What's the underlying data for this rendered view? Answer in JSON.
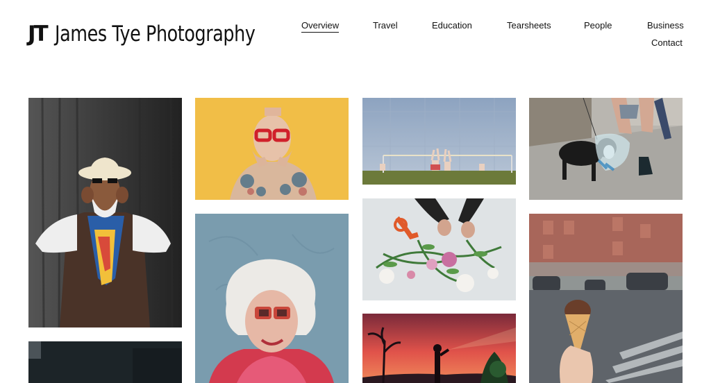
{
  "site": {
    "logo_mark": "JT",
    "title": "James Tye Photography"
  },
  "nav": {
    "items": [
      {
        "label": "Overview",
        "active": true
      },
      {
        "label": "Travel"
      },
      {
        "label": "Education"
      },
      {
        "label": "Tearsheets"
      },
      {
        "label": "People"
      },
      {
        "label": "Business"
      },
      {
        "label": "Contact"
      }
    ]
  },
  "gallery": {
    "photos": [
      {
        "name": "man-in-hat"
      },
      {
        "name": "tattooed-man-red-glasses"
      },
      {
        "name": "beach-volleyball"
      },
      {
        "name": "dog-with-cone"
      },
      {
        "name": "dark-photo"
      },
      {
        "name": "woman-with-sunglasses"
      },
      {
        "name": "flower-arrangement"
      },
      {
        "name": "ice-cream-street"
      },
      {
        "name": "sunset-silhouette"
      }
    ]
  }
}
